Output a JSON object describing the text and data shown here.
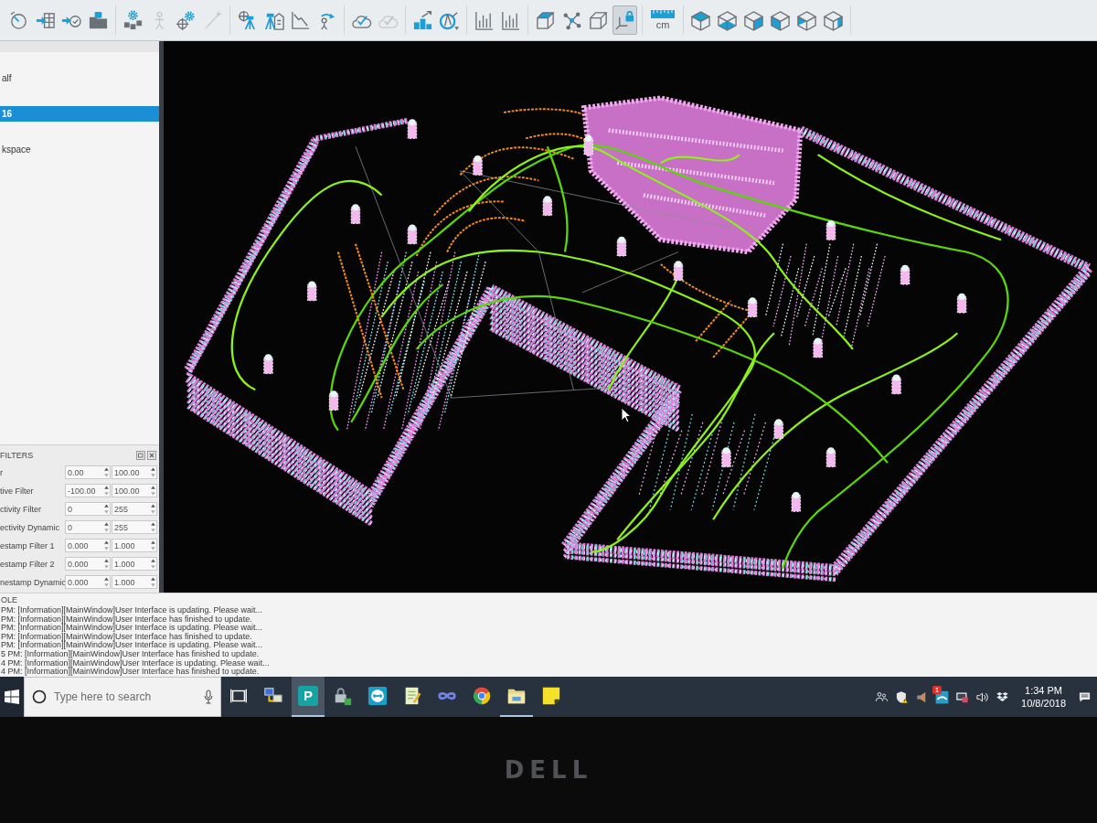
{
  "toolbar": {
    "groups": [
      [
        {
          "kind": "dial",
          "selected": false,
          "disabled": false
        },
        {
          "kind": "import",
          "selected": false,
          "disabled": false
        },
        {
          "kind": "checkin",
          "selected": false,
          "disabled": false
        },
        {
          "kind": "folder",
          "selected": false,
          "disabled": false
        }
      ],
      [
        {
          "kind": "gears",
          "selected": false,
          "disabled": false
        },
        {
          "kind": "pose",
          "selected": false,
          "disabled": true
        },
        {
          "kind": "gear",
          "selected": false,
          "disabled": false
        },
        {
          "kind": "wand",
          "selected": false,
          "disabled": true
        }
      ],
      [
        {
          "kind": "tripod",
          "selected": false,
          "disabled": false
        },
        {
          "kind": "station",
          "selected": false,
          "disabled": false
        },
        {
          "kind": "decline",
          "selected": false,
          "disabled": false
        },
        {
          "kind": "rotate",
          "selected": false,
          "disabled": false
        }
      ],
      [
        {
          "kind": "cloudcheck",
          "selected": false,
          "disabled": false
        },
        {
          "kind": "cloudcheck",
          "selected": false,
          "disabled": true
        }
      ],
      [
        {
          "kind": "blocks",
          "selected": false,
          "disabled": false
        },
        {
          "kind": "compass",
          "selected": false,
          "disabled": false
        }
      ],
      [
        {
          "kind": "bars",
          "selected": false,
          "disabled": false
        },
        {
          "kind": "bars",
          "selected": false,
          "disabled": false
        }
      ],
      [
        {
          "kind": "cube",
          "selected": false,
          "disabled": false
        },
        {
          "kind": "nodes",
          "selected": false,
          "disabled": false
        },
        {
          "kind": "wirecube",
          "selected": false,
          "disabled": false
        },
        {
          "kind": "axeslock",
          "selected": true,
          "disabled": false
        }
      ],
      [
        {
          "kind": "scale",
          "label": "cm",
          "selected": false,
          "disabled": false
        }
      ],
      [
        {
          "kind": "viewtop",
          "selected": false,
          "disabled": false
        },
        {
          "kind": "viewbottom",
          "selected": false,
          "disabled": false
        },
        {
          "kind": "viewright",
          "selected": false,
          "disabled": false
        },
        {
          "kind": "viewleft",
          "selected": false,
          "disabled": false
        },
        {
          "kind": "viewfront",
          "selected": false,
          "disabled": false
        },
        {
          "kind": "viewback",
          "selected": false,
          "disabled": false
        }
      ]
    ]
  },
  "db_tree": {
    "items": [
      {
        "label": "alf",
        "selected": false
      },
      {
        "label": "16",
        "selected": true
      },
      {
        "label": "kspace",
        "selected": false
      }
    ]
  },
  "filters": {
    "title": "FILTERS",
    "rows": [
      {
        "label": "r",
        "min": "0.00",
        "max": "100.00"
      },
      {
        "label": "tive Filter",
        "min": "-100.00",
        "max": "100.00"
      },
      {
        "label": "ctivity Filter",
        "min": "0",
        "max": "255"
      },
      {
        "label": "ectivity Dynamic",
        "min": "0",
        "max": "255"
      },
      {
        "label": "estamp Filter 1",
        "min": "0.000",
        "max": "1.000"
      },
      {
        "label": "estamp Filter 2",
        "min": "0.000",
        "max": "1.000"
      },
      {
        "label": "nestamp Dynamic",
        "min": "0.000",
        "max": "1.000"
      }
    ]
  },
  "console": {
    "title": "OLE",
    "lines": [
      "PM: [Information][MainWindow]User Interface is updating. Please wait...",
      "PM: [Information][MainWindow]User Interface has finished to update.",
      "PM: [Information][MainWindow]User Interface is updating. Please wait...",
      "PM: [Information][MainWindow]User Interface has finished to update.",
      "PM: [Information][MainWindow]User Interface is updating. Please wait...",
      "5 PM: [Information][MainWindow]User Interface has finished to update.",
      "4 PM: [Information][MainWindow]User Interface is updating. Please wait...",
      "4 PM: [Information][MainWindow]User Interface has finished to update."
    ]
  },
  "taskbar": {
    "search": {
      "placeholder": "Type here to search"
    },
    "apps": [
      {
        "kind": "network",
        "selected": false,
        "running": false
      },
      {
        "kind": "letter",
        "label": "P",
        "selected": true,
        "running": true
      },
      {
        "kind": "lockapp",
        "selected": false,
        "running": false
      },
      {
        "kind": "remote",
        "selected": false,
        "running": false
      },
      {
        "kind": "notes",
        "selected": false,
        "running": false
      },
      {
        "kind": "infinity",
        "selected": false,
        "running": false
      },
      {
        "kind": "browser",
        "selected": false,
        "running": false
      },
      {
        "kind": "folder",
        "selected": false,
        "running": true
      },
      {
        "kind": "sticky",
        "selected": false,
        "running": false
      }
    ],
    "tray": {
      "badge": "1"
    },
    "clock": {
      "time": "1:34 PM",
      "date": "10/8/2018"
    }
  },
  "monitor": {
    "logo": "DELL"
  }
}
